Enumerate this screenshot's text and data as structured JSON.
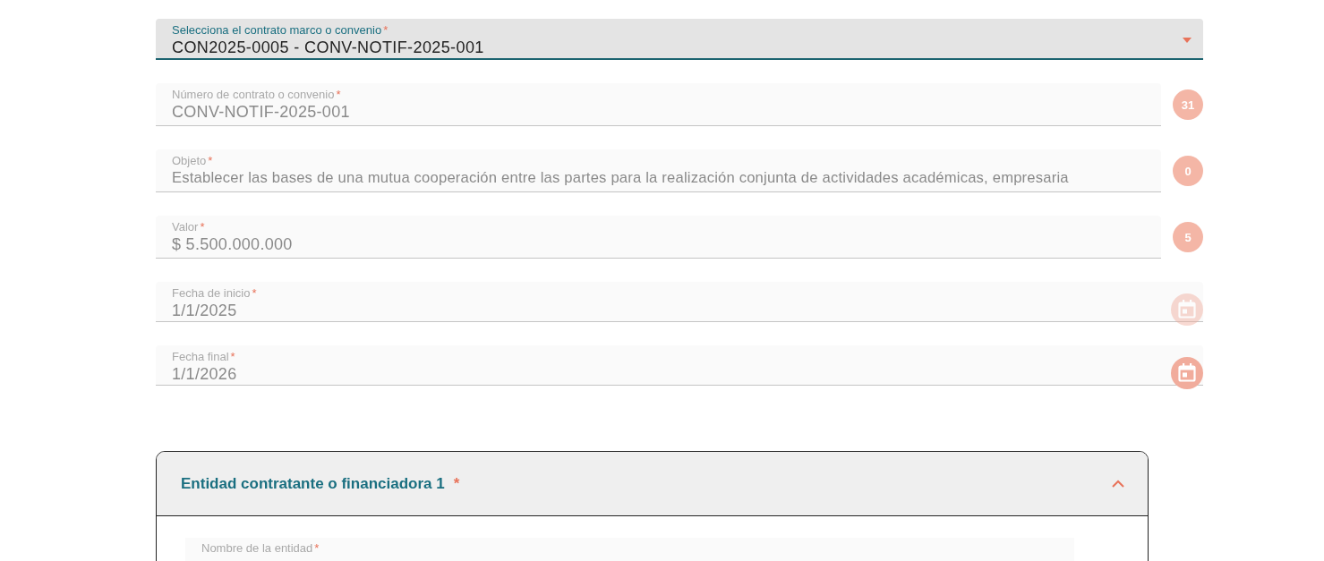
{
  "fields": [
    {
      "kind": "select",
      "label": "Selecciona el contrato marco o convenio",
      "mark": "*",
      "value": "CON2025-0005 - CONV-NOTIF-2025-001"
    },
    {
      "kind": "counter",
      "label": "Número de contrato o convenio",
      "mark": "*",
      "value": "CONV-NOTIF-2025-001",
      "count": "31"
    },
    {
      "kind": "counter",
      "label": "Objeto",
      "mark": "*",
      "value": "Establecer las bases de una mutua cooperación entre las partes para la realización conjunta de actividades académicas, empresaria",
      "count": "0"
    },
    {
      "kind": "counter",
      "label": "Valor",
      "mark": "*",
      "value": "$ 5.500.000.000",
      "count": "5"
    },
    {
      "kind": "date",
      "label": "Fecha de inicio",
      "mark": "*",
      "value": "1/1/2025",
      "disabled": true
    },
    {
      "kind": "date",
      "label": "Fecha final",
      "mark": "*",
      "value": "1/1/2026",
      "disabled": false
    }
  ],
  "section": {
    "title": "Entidad contratante o financiadora 1",
    "mark": "*",
    "expanded": true,
    "fields": [
      {
        "label": "Nombre de la entidad",
        "mark": "*"
      }
    ]
  }
}
